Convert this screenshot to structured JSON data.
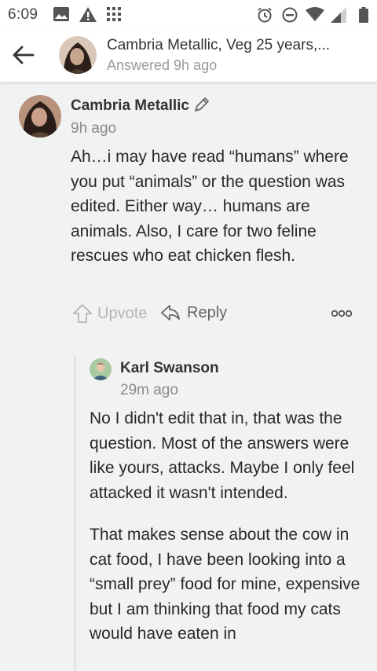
{
  "status_bar": {
    "time": "6:09",
    "icons_left": [
      "image-icon",
      "warning-icon",
      "grid-icon"
    ],
    "icons_right": [
      "alarm-icon",
      "do-not-disturb-icon",
      "wifi-icon",
      "signal-icon",
      "battery-icon"
    ]
  },
  "header": {
    "title": "Cambria Metallic, Veg 25 years,...",
    "subtitle": "Answered 9h ago"
  },
  "comment1": {
    "author": "Cambria Metallic",
    "time": "9h ago",
    "body": "Ah…i may have read “humans” where you put “animals” or the question was edited. Either way… humans are animals. Also, I care for two feline rescues who eat chicken flesh.",
    "upvote_label": "Upvote",
    "reply_label": "Reply"
  },
  "comment2": {
    "author": "Karl Swanson",
    "time": "29m ago",
    "paragraphs": [
      "No I didn't edit that in, that was the question. Most of the answers were like yours, attacks. Maybe I only feel attacked it wasn't intended.",
      "That makes sense about the cow in cat food, I have been looking into a “small prey” food for mine, expensive but I am thinking that food my cats would have eaten in"
    ]
  },
  "colors": {
    "background": "#f1f2f2",
    "text": "#282829",
    "muted": "#8a8a8a",
    "thread_line": "#e2e3e3"
  }
}
